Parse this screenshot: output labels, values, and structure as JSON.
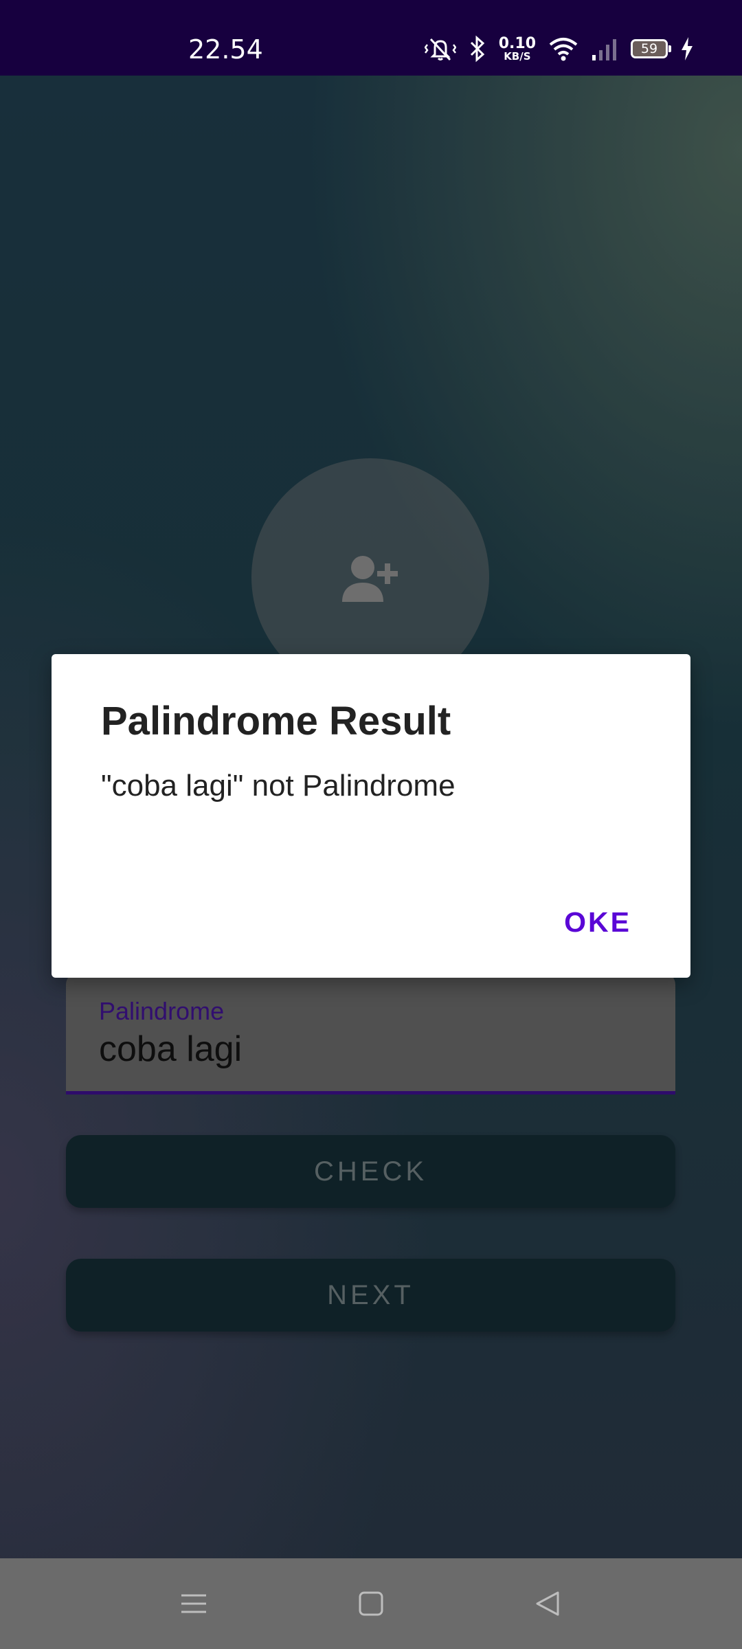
{
  "status_bar": {
    "time": "22.54",
    "net_speed_value": "0.10",
    "net_speed_unit": "KB/S",
    "battery_level": "59",
    "icons": [
      "vibrate-mute-icon",
      "bluetooth-icon",
      "wifi-icon",
      "signal-icon",
      "battery-icon",
      "charging-icon"
    ]
  },
  "profile": {
    "icon": "add-person-icon"
  },
  "form": {
    "palindrome_label": "Palindrome",
    "palindrome_value": "coba lagi",
    "check_label": "CHECK",
    "next_label": "NEXT"
  },
  "dialog": {
    "title": "Palindrome Result",
    "message": "\"coba lagi\" not Palindrome",
    "ok_label": "OKE"
  },
  "nav_bar": {
    "icons": [
      "menu-icon",
      "home-icon",
      "back-icon"
    ]
  },
  "colors": {
    "status_bar": "#17003f",
    "accent": "#5a06d6",
    "input_underline": "#3b108a",
    "button_bg": "#142b33"
  }
}
